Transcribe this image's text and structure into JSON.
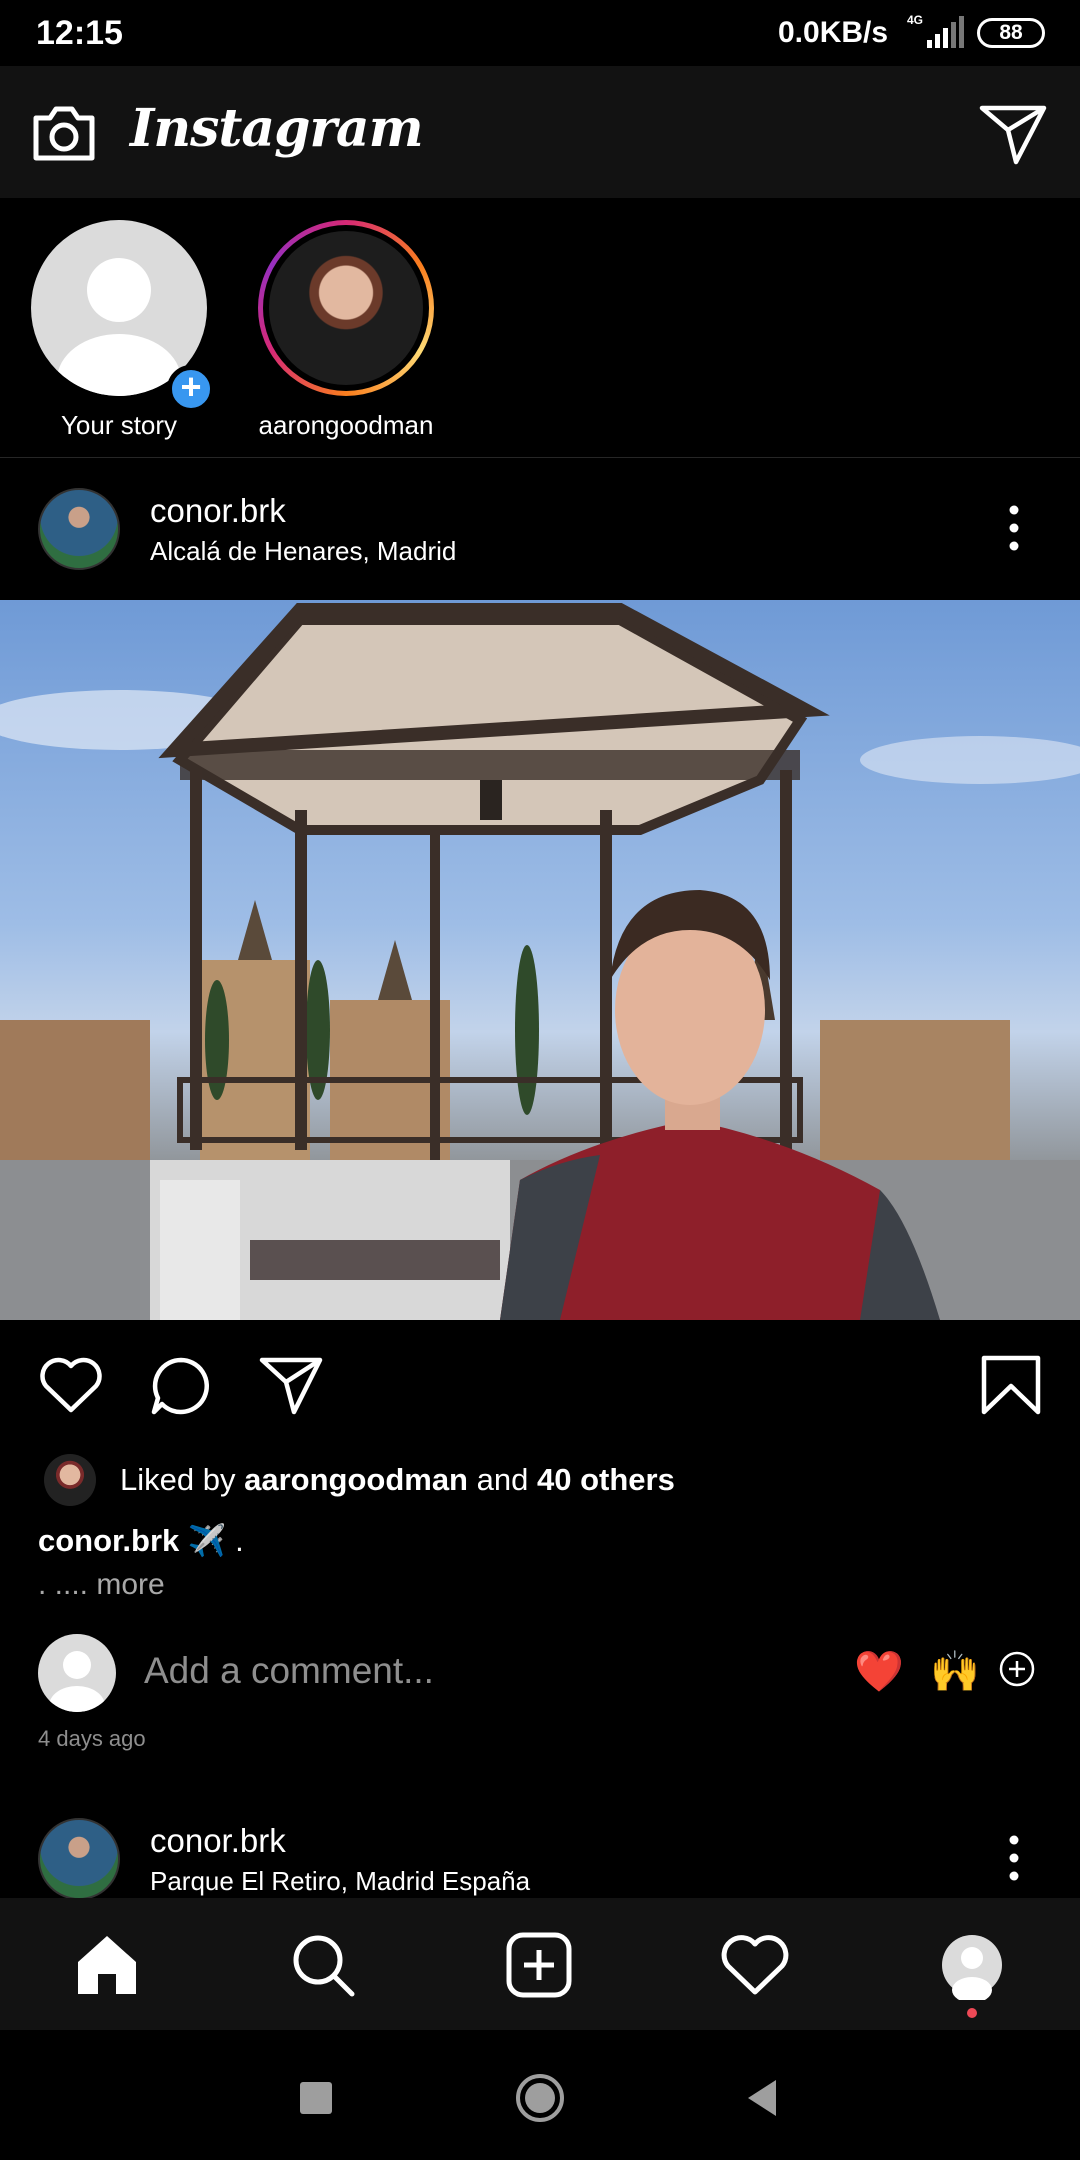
{
  "status_bar": {
    "time": "12:15",
    "speed": "0.0KB/s",
    "network": "4G",
    "battery": "88"
  },
  "header": {
    "app_name": "Instagram"
  },
  "stories": [
    {
      "label": "Your story"
    },
    {
      "label": "aarongoodman"
    }
  ],
  "post1": {
    "username": "conor.brk",
    "location": "Alcalá de Henares, Madrid",
    "liked_by_prefix": "Liked by",
    "liked_by_user": "aarongoodman",
    "liked_by_and": "and",
    "liked_by_others": "40 others",
    "caption_user": "conor.brk",
    "caption_text": "✈️ .",
    "caption_more_prefix": ". ....",
    "caption_more": "more",
    "comment_placeholder": "Add a comment...",
    "reactions": [
      "❤️",
      "🙌"
    ],
    "timestamp": "4 days ago"
  },
  "post2": {
    "username": "conor.brk",
    "location": "Parque El Retiro, Madrid España"
  },
  "icons": {
    "camera": "camera-icon",
    "direct": "direct-message-icon",
    "like": "heart-icon",
    "comment": "comment-icon",
    "share": "share-icon",
    "save": "bookmark-icon",
    "home": "home-icon",
    "search": "search-icon",
    "new_post": "add-post-icon",
    "activity": "heart-icon",
    "profile": "profile-icon"
  },
  "colors": {
    "story_badge": "#3897f0",
    "notification_dot": "#ed4956",
    "header_bg": "#121212"
  }
}
